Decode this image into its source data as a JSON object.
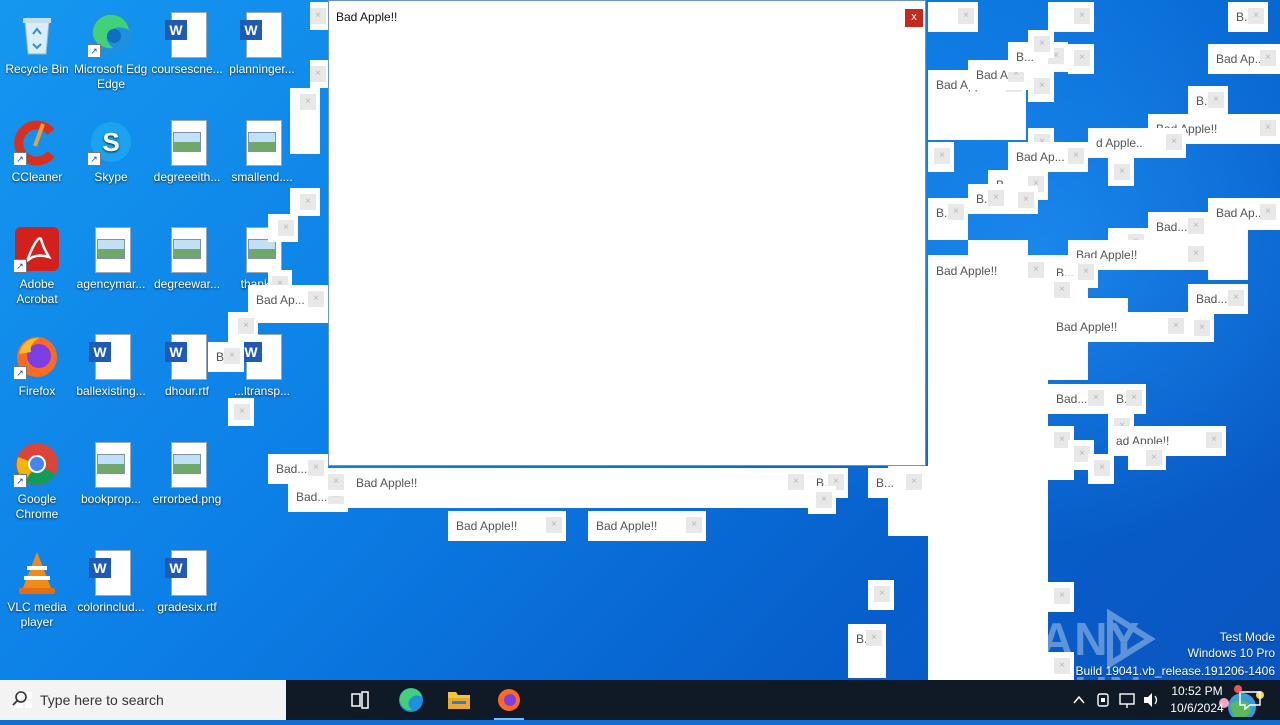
{
  "desktop": {
    "icons": [
      {
        "label": "Recycle Bin",
        "icon": "recycle-bin-icon"
      },
      {
        "label": "Microsoft Edge",
        "icon": "edge-icon"
      },
      {
        "label": "coursescne...",
        "icon": "word-doc-icon"
      },
      {
        "label": "planninger...",
        "icon": "word-doc-icon"
      },
      {
        "label": "CCleaner",
        "icon": "ccleaner-icon"
      },
      {
        "label": "Skype",
        "icon": "skype-icon"
      },
      {
        "label": "degreeeith...",
        "icon": "image-file-icon"
      },
      {
        "label": "smallend....",
        "icon": "image-file-icon"
      },
      {
        "label": "Adobe Acrobat",
        "icon": "acrobat-icon"
      },
      {
        "label": "agencymar...",
        "icon": "image-file-icon"
      },
      {
        "label": "degreewar...",
        "icon": "image-file-icon"
      },
      {
        "label": "thankr...",
        "icon": "image-file-icon"
      },
      {
        "label": "Firefox",
        "icon": "firefox-icon"
      },
      {
        "label": "ballexisting...",
        "icon": "word-doc-icon"
      },
      {
        "label": "dhour.rtf",
        "icon": "word-doc-icon"
      },
      {
        "label": "...ltransp...",
        "icon": "word-doc-icon"
      },
      {
        "label": "Google Chrome",
        "icon": "chrome-icon"
      },
      {
        "label": "bookprop...",
        "icon": "image-file-icon"
      },
      {
        "label": "errorbed.png",
        "icon": "image-file-icon"
      },
      {
        "label": "VLC media player",
        "icon": "vlc-icon"
      },
      {
        "label": "colorinclud...",
        "icon": "word-doc-icon"
      },
      {
        "label": "gradesix.rtf",
        "icon": "word-doc-icon"
      }
    ]
  },
  "main_window": {
    "title": "Bad Apple!!",
    "close": "x"
  },
  "popups": {
    "full": "Bad Apple!!",
    "mid": "Bad Ap...",
    "short": "Bad...",
    "tiny": "B...",
    "b": "B.",
    "ba": "Bad A...",
    "frag_apple": "d Apple..",
    "frag_ad": "ad Apple!!",
    "frag_bapple": "B Apple..."
  },
  "watermark": {
    "text": "ANY RUN"
  },
  "system_info": {
    "mode": "Test Mode",
    "os": "Windows 10 Pro",
    "build": "Build 19041.vb_release.191206-1406"
  },
  "taskbar": {
    "search_placeholder": "Type here to search",
    "time": "10:52 PM",
    "date": "10/6/2024"
  },
  "colors": {
    "taskbar": "#101a26",
    "desktop": "#0c7fe6",
    "close_button": "#c42b1c"
  }
}
